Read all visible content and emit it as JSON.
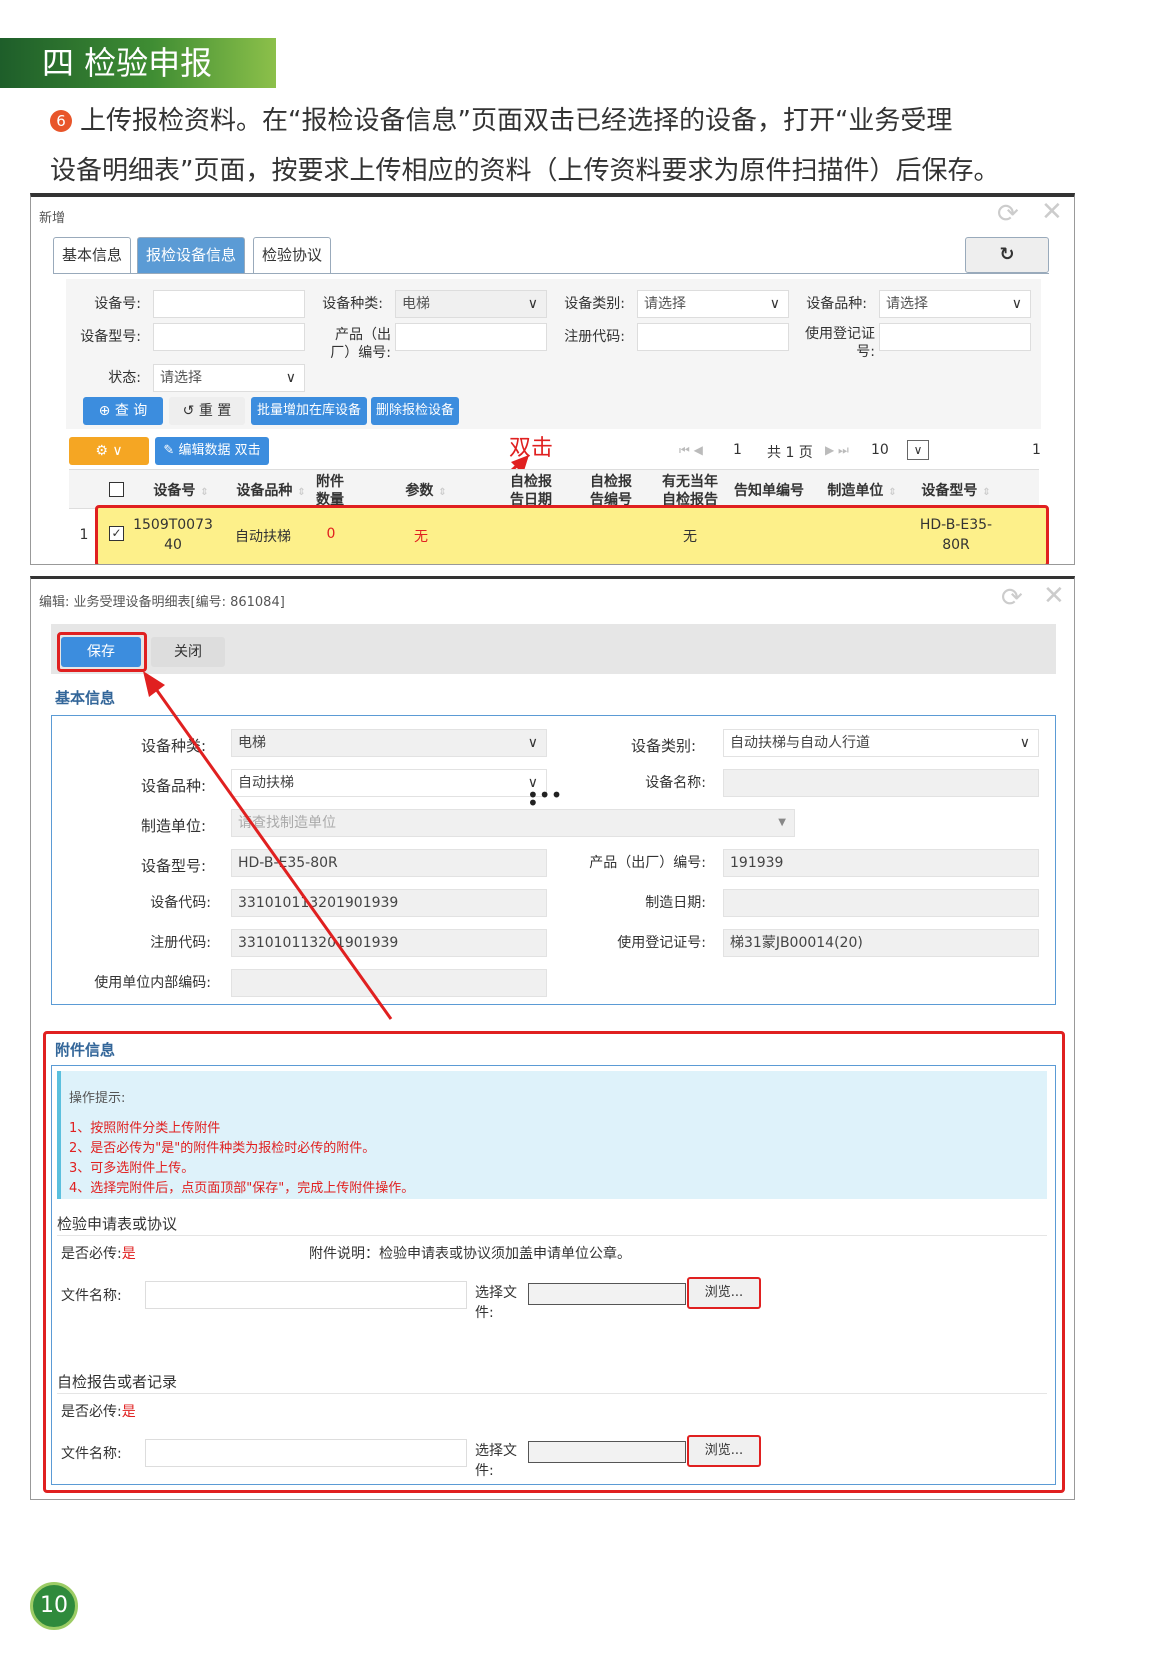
{
  "section_title": "四 检验申报",
  "intro": {
    "num": "6",
    "line1": "上传报检资料。在“报检设备信息”页面双击已经选择的设备，打开“业务受理",
    "line2": "设备明细表”页面，按要求上传相应的资料（上传资料要求为原件扫描件）后保存。"
  },
  "win1": {
    "title": "新增",
    "tabs": [
      "基本信息",
      "报检设备信息",
      "检验协议"
    ],
    "filters": {
      "device_no": "设备号:",
      "device_kind": "设备种类:",
      "device_kind_val": "电梯",
      "device_cat": "设备类别:",
      "device_cat_val": "请选择",
      "device_var": "设备品种:",
      "device_var_val": "请选择",
      "device_model": "设备型号:",
      "product_no_l1": "产品（出",
      "product_no_l2": "厂）编号:",
      "reg_code": "注册代码:",
      "use_reg_l1": "使用登记证",
      "use_reg_l2": "号:",
      "status": "状态:",
      "status_val": "请选择"
    },
    "buttons": {
      "query": "查 询",
      "reset": "重 置",
      "batch_add": "批量增加在库设备",
      "delete": "删除报检设备",
      "edit": "编辑数据 双击"
    },
    "annotation": "双击",
    "pager": {
      "page": "1",
      "total": "共 1 页",
      "size": "10",
      "right": "1"
    },
    "columns": {
      "device_no": "设备号",
      "device_var": "设备品种",
      "attach_l1": "附件",
      "attach_l2": "数量",
      "params": "参数",
      "self_date_l1": "自检报",
      "self_date_l2": "告日期",
      "self_no_l1": "自检报",
      "self_no_l2": "告编号",
      "has_self_l1": "有无当年",
      "has_self_l2": "自检报告",
      "notice_no": "告知单编号",
      "maker": "制造单位",
      "model": "设备型号"
    },
    "row": {
      "idx": "1",
      "device_no_l1": "1509T0073",
      "device_no_l2": "40",
      "device_var": "自动扶梯",
      "attach": "0",
      "params": "无",
      "has_self": "无",
      "model_l1": "HD-B-E35-",
      "model_l2": "80R"
    }
  },
  "win2": {
    "title": "编辑: 业务受理设备明细表[编号: 861084]",
    "save": "保存",
    "close": "关闭",
    "basic": "基本信息",
    "fields": {
      "kind": "设备种类:",
      "kind_val": "电梯",
      "cat": "设备类别:",
      "cat_val": "自动扶梯与自动人行道",
      "var": "设备品种:",
      "var_val": "自动扶梯",
      "name": "设备名称:",
      "maker": "制造单位:",
      "maker_ph": "请查找制造单位",
      "model": "设备型号:",
      "model_val": "HD-B-E35-80R",
      "product_no": "产品（出厂）编号:",
      "product_no_val": "191939",
      "code": "设备代码:",
      "code_val": "3310101132019019​39",
      "made_date": "制造日期:",
      "reg": "注册代码:",
      "reg_val": "3310101132019019​39",
      "use_reg": "使用登记证号:",
      "use_reg_val": "梯31蒙JB00014(20)",
      "internal": "使用单位内部编码:"
    },
    "attach": {
      "title": "附件信息",
      "hint_title": "操作提示:",
      "hints": [
        "1、按照附件分类上传附件",
        "2、是否必传为\"是\"的附件种类为报检时必传的附件。",
        "3、可多选附件上传。",
        "4、选择完附件后，点页面顶部\"保存\"，完成上传附件操作。"
      ],
      "g1": {
        "title": "检验申请表或协议",
        "req": "是否必传:",
        "req_val": "是",
        "desc": "附件说明：检验申请表或协议须加盖申请单位公章。",
        "file": "文件名称:",
        "choose_l1": "选择文",
        "choose_l2": "件:",
        "browse": "浏览..."
      },
      "g2": {
        "title": "自检报告或者记录",
        "req": "是否必传:",
        "req_val": "是",
        "file": "文件名称:",
        "choose_l1": "选择文",
        "choose_l2": "件:",
        "browse": "浏览..."
      }
    }
  },
  "page_no": "10"
}
